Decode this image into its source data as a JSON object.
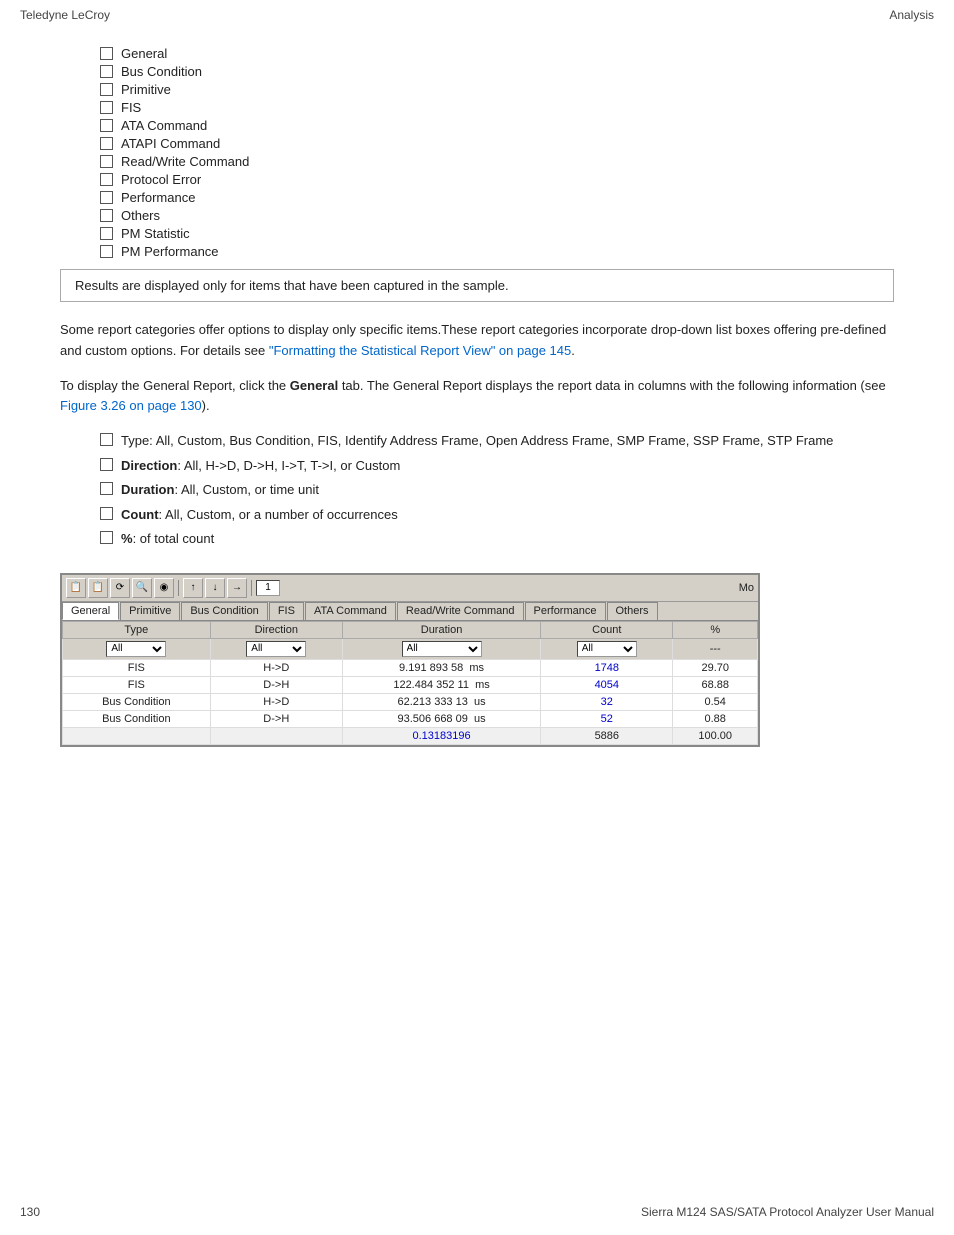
{
  "header": {
    "left": "Teledyne LeCroy",
    "right": "Analysis"
  },
  "checklist": {
    "items": [
      "General",
      "Bus Condition",
      "Primitive",
      "FIS",
      "ATA Command",
      "ATAPI Command",
      "Read/Write Command",
      "Protocol Error",
      "Performance",
      "Others",
      "PM Statistic",
      "PM Performance"
    ]
  },
  "notice": "Results are displayed only for items that have been captured in the sample.",
  "paragraph1": "Some report categories offer options to display only specific items.These report categories incorporate drop-down list boxes offering pre-defined and custom options. For details see ",
  "paragraph1_link": "\"Formatting the Statistical Report View\" on page 145",
  "paragraph1_end": ".",
  "paragraph2_pre": "To display the General Report, click the ",
  "paragraph2_bold": "General",
  "paragraph2_post": " tab. The General Report displays the report data in columns with the following information (see ",
  "paragraph2_link": "Figure 3.26 on page 130",
  "paragraph2_end": ").",
  "bullets": [
    {
      "label": "",
      "text": "Type: All, Custom, Bus Condition, FIS, Identify Address Frame, Open Address Frame, SMP Frame, SSP Frame, STP Frame"
    },
    {
      "bold": "Direction",
      "text": ": All, H->D, D->H, I->T, T->I, or Custom"
    },
    {
      "bold": "Duration",
      "text": ": All, Custom, or time unit"
    },
    {
      "bold": "Count",
      "text": ": All, Custom, or a number of occurrences"
    },
    {
      "bold": "%",
      "text": ": of total count"
    }
  ],
  "toolbar": {
    "buttons": [
      "📋",
      "📋",
      "🔁",
      "🔍",
      "🎯",
      "↑",
      "↓",
      "→"
    ],
    "input_value": "1",
    "mo_label": "Mo"
  },
  "tabs": [
    "General",
    "Primitive",
    "Bus Condition",
    "FIS",
    "ATA Command",
    "Read/Write Command",
    "Performance",
    "Others"
  ],
  "table": {
    "headers": [
      "Type",
      "Direction",
      "Duration",
      "Count",
      "%"
    ],
    "filter_row": [
      "All",
      "All",
      "All",
      "All",
      "---"
    ],
    "rows": [
      {
        "type": "FIS",
        "direction": "H->D",
        "duration": "9.191 893 58  ms",
        "count": "1748",
        "pct": "29.70"
      },
      {
        "type": "FIS",
        "direction": "D->H",
        "duration": "122.484 352 11  ms",
        "count": "4054",
        "pct": "68.88"
      },
      {
        "type": "Bus Condition",
        "direction": "H->D",
        "duration": "62.213 333 13  us",
        "count": "32",
        "pct": "0.54"
      },
      {
        "type": "Bus Condition",
        "direction": "D->H",
        "duration": "93.506 668 09  us",
        "count": "52",
        "pct": "0.88"
      },
      {
        "type": "",
        "direction": "",
        "duration": "0.13183196",
        "count": "5886",
        "pct": "100.00"
      }
    ]
  },
  "footer": {
    "left": "130",
    "right": "Sierra M124 SAS/SATA Protocol Analyzer User Manual"
  }
}
